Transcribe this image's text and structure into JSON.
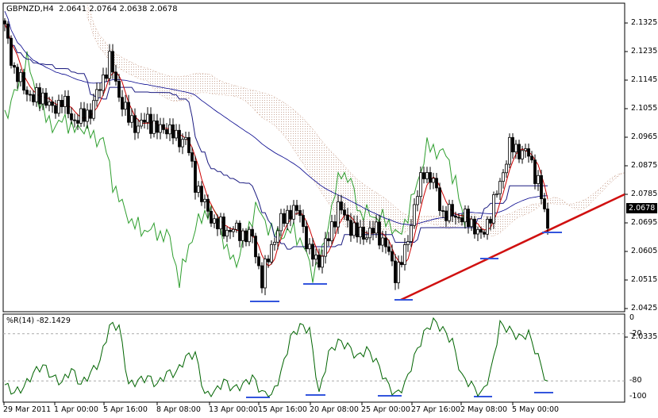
{
  "header": {
    "symbol": "GBPNZD,H4",
    "open": "2.0641",
    "high": "2.0764",
    "low": "2.0638",
    "close": "2.0678"
  },
  "indicator": {
    "name": "%R(14)",
    "value": "-82.1429"
  },
  "price_axis": [
    "2.1325",
    "2.1235",
    "2.1145",
    "2.1055",
    "2.0965",
    "2.0875",
    "2.0785",
    "2.0695",
    "2.0605",
    "2.0515",
    "2.0425",
    "2.0335"
  ],
  "current_price": "2.0678",
  "indicator_axis": [
    "0",
    "-20",
    "-80",
    "-100"
  ],
  "time_axis": [
    "29 Mar 2011",
    "1 Apr 00:00",
    "5 Apr 16:00",
    "8 Apr 08:00",
    "13 Apr 00:00",
    "15 Apr 16:00",
    "20 Apr 08:00",
    "25 Apr 00:00",
    "27 Apr 16:00",
    "2 May 08:00",
    "5 May 00:00"
  ],
  "colors": {
    "bull": "#000000",
    "bear": "#000000",
    "ma_fast": "#cc0000",
    "ma_slow": "#00008b",
    "chikou": "#2e9e2e",
    "trend": "#d01010",
    "support": "#3355dd",
    "wpr": "#006400"
  },
  "chart_data": {
    "type": "candlestick",
    "title": "GBPNZD,H4",
    "ylim": [
      2.0335,
      2.1325
    ],
    "anchor_closes": [
      2.131,
      2.1173,
      2.1123,
      2.1085,
      2.1098,
      2.1048,
      2.1085,
      2.1023,
      2.1023,
      2.1048,
      2.1123,
      2.121,
      2.1098,
      2.1023,
      2.0998,
      2.1023,
      2.0985,
      2.0998,
      2.096,
      2.096,
      2.0823,
      2.0748,
      2.0698,
      2.0673,
      2.0673,
      2.066,
      2.0648,
      2.051,
      2.0623,
      2.0698,
      2.0735,
      2.0723,
      2.0598,
      2.0573,
      2.0648,
      2.0748,
      2.0698,
      2.066,
      2.066,
      2.0673,
      2.0623,
      2.0535,
      2.0598,
      2.0748,
      2.086,
      2.0823,
      2.0723,
      2.0723,
      2.071,
      2.0698,
      2.0648,
      2.0723,
      2.0823,
      2.0935,
      2.0923,
      2.091,
      2.0823,
      2.0678
    ],
    "wpr_ylim": [
      -100,
      0
    ],
    "wpr_levels": [
      -20,
      -80
    ],
    "wpr_anchors": [
      -85,
      -95,
      -88,
      -70,
      -60,
      -75,
      -82,
      -65,
      -85,
      -70,
      -55,
      -10,
      -10,
      -85,
      -80,
      -75,
      -85,
      -70,
      -70,
      -50,
      -45,
      -98,
      -95,
      -80,
      -90,
      -85,
      -75,
      -95,
      -100,
      -70,
      -25,
      -10,
      -15,
      -97,
      -45,
      -30,
      -35,
      -50,
      -40,
      -55,
      -80,
      -98,
      -85,
      -50,
      -20,
      -3,
      -15,
      -30,
      -75,
      -85,
      -98,
      -70,
      -8,
      -15,
      -25,
      -20,
      -50,
      -85
    ]
  }
}
